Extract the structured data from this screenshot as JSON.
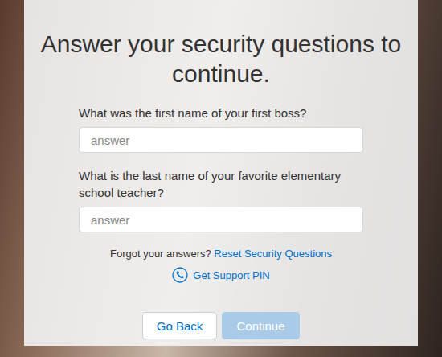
{
  "title": "Answer your security questions to continue.",
  "questions": [
    {
      "label": "What was the first name of your first boss?",
      "placeholder": "answer"
    },
    {
      "label": "What is the last name of your favorite elementary school teacher?",
      "placeholder": "answer"
    }
  ],
  "forgot": {
    "text": "Forgot your answers?",
    "link": "Reset Security Questions"
  },
  "support": {
    "label": "Get Support PIN"
  },
  "buttons": [
    {
      "label": "Go Back",
      "disabled": false
    },
    {
      "label": "Continue",
      "disabled": true
    }
  ]
}
